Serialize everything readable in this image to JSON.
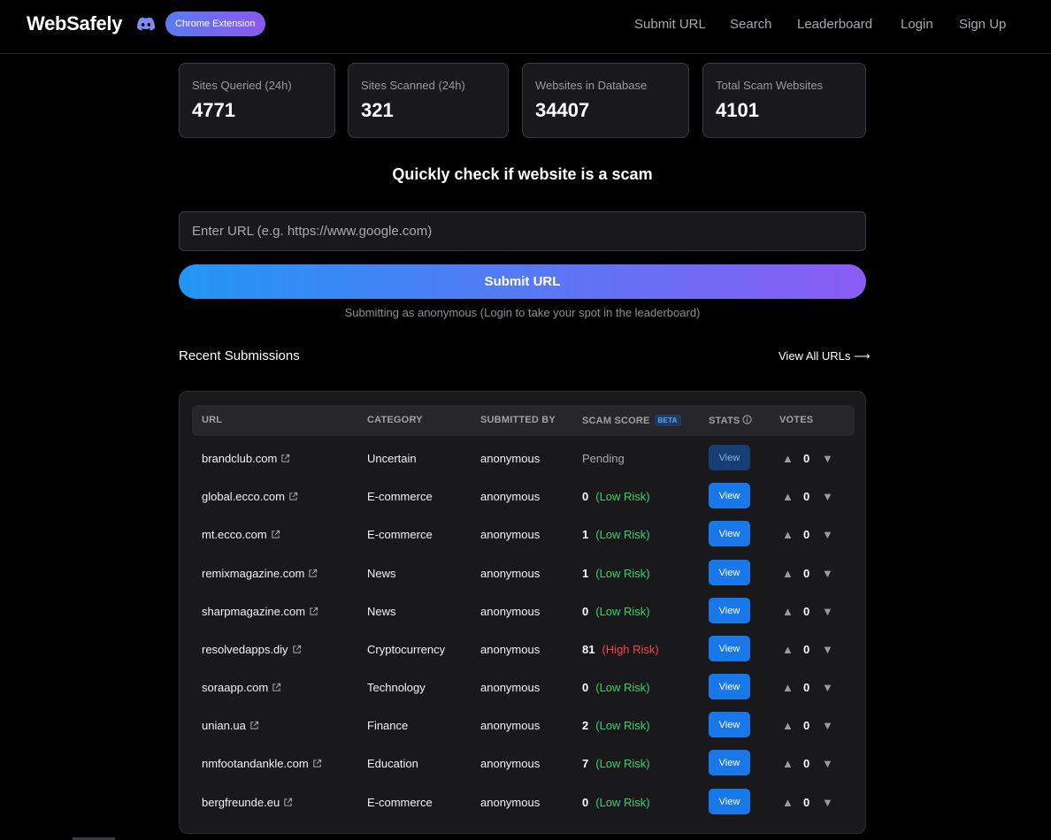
{
  "brand": {
    "name": "WebSafely",
    "extension_label": "Chrome Extension"
  },
  "nav": [
    "Submit URL",
    "Search",
    "Leaderboard",
    "Login",
    "Sign Up"
  ],
  "stats": [
    {
      "label": "Sites Queried (24h)",
      "value": "4771"
    },
    {
      "label": "Sites Scanned (24h)",
      "value": "321"
    },
    {
      "label": "Websites in Database",
      "value": "34407"
    },
    {
      "label": "Total Scam Websites",
      "value": "4101"
    }
  ],
  "checker": {
    "headline": "Quickly check if website is a scam",
    "placeholder": "Enter URL (e.g. https://www.google.com)",
    "submit_label": "Submit URL",
    "note": "Submitting as anonymous (Login to take your spot in the leaderboard)"
  },
  "recent": {
    "title": "Recent Submissions",
    "view_all": "View All URLs ⟶",
    "columns": {
      "url": "URL",
      "category": "CATEGORY",
      "submitted_by": "SUBMITTED BY",
      "scam_score": "SCAM SCORE",
      "beta": "BETA",
      "stats": "STATS",
      "votes": "VOTES"
    },
    "view_label": "View",
    "rows": [
      {
        "url": "brandclub.com",
        "category": "Uncertain",
        "submitted_by": "anonymous",
        "score": "",
        "risk": "",
        "pending": "Pending",
        "votes": "0"
      },
      {
        "url": "global.ecco.com",
        "category": "E-commerce",
        "submitted_by": "anonymous",
        "score": "0",
        "risk": "(Low Risk)",
        "pending": "",
        "votes": "0"
      },
      {
        "url": "mt.ecco.com",
        "category": "E-commerce",
        "submitted_by": "anonymous",
        "score": "1",
        "risk": "(Low Risk)",
        "pending": "",
        "votes": "0"
      },
      {
        "url": "remixmagazine.com",
        "category": "News",
        "submitted_by": "anonymous",
        "score": "1",
        "risk": "(Low Risk)",
        "pending": "",
        "votes": "0"
      },
      {
        "url": "sharpmagazine.com",
        "category": "News",
        "submitted_by": "anonymous",
        "score": "0",
        "risk": "(Low Risk)",
        "pending": "",
        "votes": "0"
      },
      {
        "url": "resolvedapps.diy",
        "category": "Cryptocurrency",
        "submitted_by": "anonymous",
        "score": "81",
        "risk": "(High Risk)",
        "pending": "",
        "votes": "0"
      },
      {
        "url": "soraapp.com",
        "category": "Technology",
        "submitted_by": "anonymous",
        "score": "0",
        "risk": "(Low Risk)",
        "pending": "",
        "votes": "0"
      },
      {
        "url": "unian.ua",
        "category": "Finance",
        "submitted_by": "anonymous",
        "score": "2",
        "risk": "(Low Risk)",
        "pending": "",
        "votes": "0"
      },
      {
        "url": "nmfootandankle.com",
        "category": "Education",
        "submitted_by": "anonymous",
        "score": "7",
        "risk": "(Low Risk)",
        "pending": "",
        "votes": "0"
      },
      {
        "url": "bergfreunde.eu",
        "category": "E-commerce",
        "submitted_by": "anonymous",
        "score": "0",
        "risk": "(Low Risk)",
        "pending": "",
        "votes": "0"
      }
    ]
  },
  "colors": {
    "accent": "#1877e9",
    "low_risk": "#3fcf6e",
    "high_risk": "#f0444f",
    "gradient_start": "#2196f3",
    "gradient_end": "#8b5cf6"
  },
  "icons": {
    "discord": "discord-icon",
    "external_link": "external-link-icon",
    "info": "info-icon",
    "upvote": "upvote-arrow-icon",
    "downvote": "downvote-arrow-icon"
  }
}
